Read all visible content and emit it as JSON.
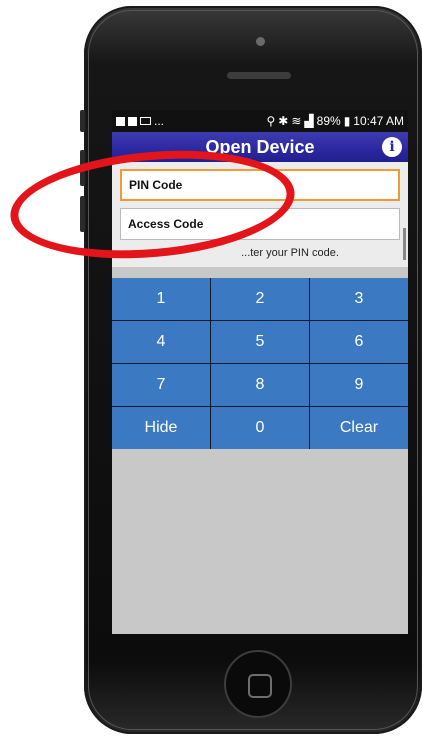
{
  "status_bar": {
    "left_ellipsis": "...",
    "battery": "89%",
    "time": "10:47 AM"
  },
  "app": {
    "title": "Open Device",
    "info_icon": "i"
  },
  "fields": {
    "pin_label": "PIN Code",
    "access_label": "Access Code",
    "hint": "...ter your PIN code."
  },
  "keypad": {
    "keys": [
      "1",
      "2",
      "3",
      "4",
      "5",
      "6",
      "7",
      "8",
      "9",
      "Hide",
      "0",
      "Clear"
    ]
  },
  "colors": {
    "title_bar": "#2b27a0",
    "key": "#3c79c3",
    "active_border": "#f29a34",
    "highlight": "#e4141b"
  }
}
